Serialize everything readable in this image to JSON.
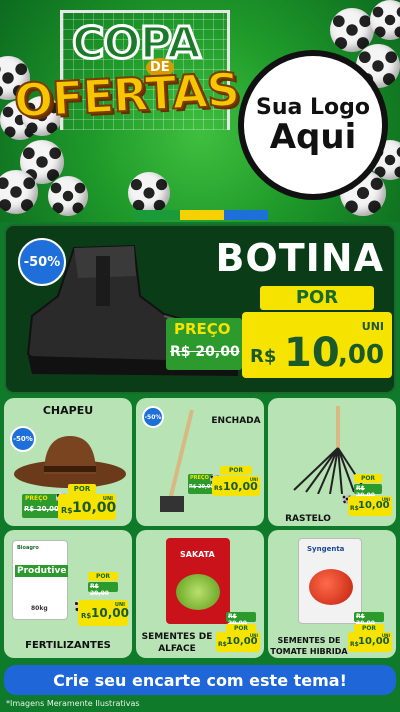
{
  "header": {
    "title_line1": "COPA",
    "title_de": "DE",
    "title_line2": "OFERTAS",
    "logo_line1": "Sua Logo",
    "logo_line2": "Aqui"
  },
  "hero": {
    "discount": "-50%",
    "product": "BOTINA",
    "por_label": "POR",
    "preco_label": "PREÇO",
    "old_price": "R$ 20,00",
    "uni_label": "UNI",
    "currency": "R$",
    "new_price_int": "10",
    "new_price_cents": ",00"
  },
  "cards": [
    {
      "name": "CHAPEU",
      "discount": "-50%",
      "preco": "PREÇO",
      "old": "R$ 20,00",
      "por": "POR",
      "uni": "UNI",
      "currency": "R$",
      "price": "10,00"
    },
    {
      "name": "ENCHADA",
      "discount": "-50%",
      "preco": "PREÇO",
      "old": "R$ 20,00",
      "por": "POR",
      "uni": "UNI",
      "currency": "R$",
      "price": "10,00"
    },
    {
      "name": "RASTELO",
      "preco": "PREÇO",
      "old": "R$ 20,00",
      "por": "POR",
      "uni": "UNI",
      "currency": "R$",
      "price": "10,00"
    },
    {
      "name": "FERTILIZANTES",
      "preco": "PREÇO",
      "old": "R$ 20,00",
      "por": "POR",
      "uni": "UNI",
      "currency": "R$",
      "price": "10,00",
      "pack_text": "Produtive",
      "pack_weight": "80kg",
      "pack_brand": "Bioagro"
    },
    {
      "name_line1": "SEMENTES DE",
      "name_line2": "ALFACE",
      "preco": "PREÇO",
      "old": "R$ 20,00",
      "por": "POR",
      "uni": "UNI",
      "currency": "R$",
      "price": "10,00",
      "pack_text": "SAKATA"
    },
    {
      "name_line1": "SEMENTES DE",
      "name_line2": "TOMATE HIBRIDA",
      "preco": "PREÇO",
      "old": "R$ 20,00",
      "por": "POR",
      "uni": "UNI",
      "currency": "R$",
      "price": "10,00",
      "pack_text": "Syngenta"
    }
  ],
  "cta": "Crie seu encarte com este tema!",
  "disclaimer": "*Imagens Meramente Ilustrativas",
  "colors": {
    "green_dark": "#0a3d17",
    "yellow": "#f7e300",
    "blue": "#1e6fd9",
    "card_green": "#b7e3b5"
  }
}
